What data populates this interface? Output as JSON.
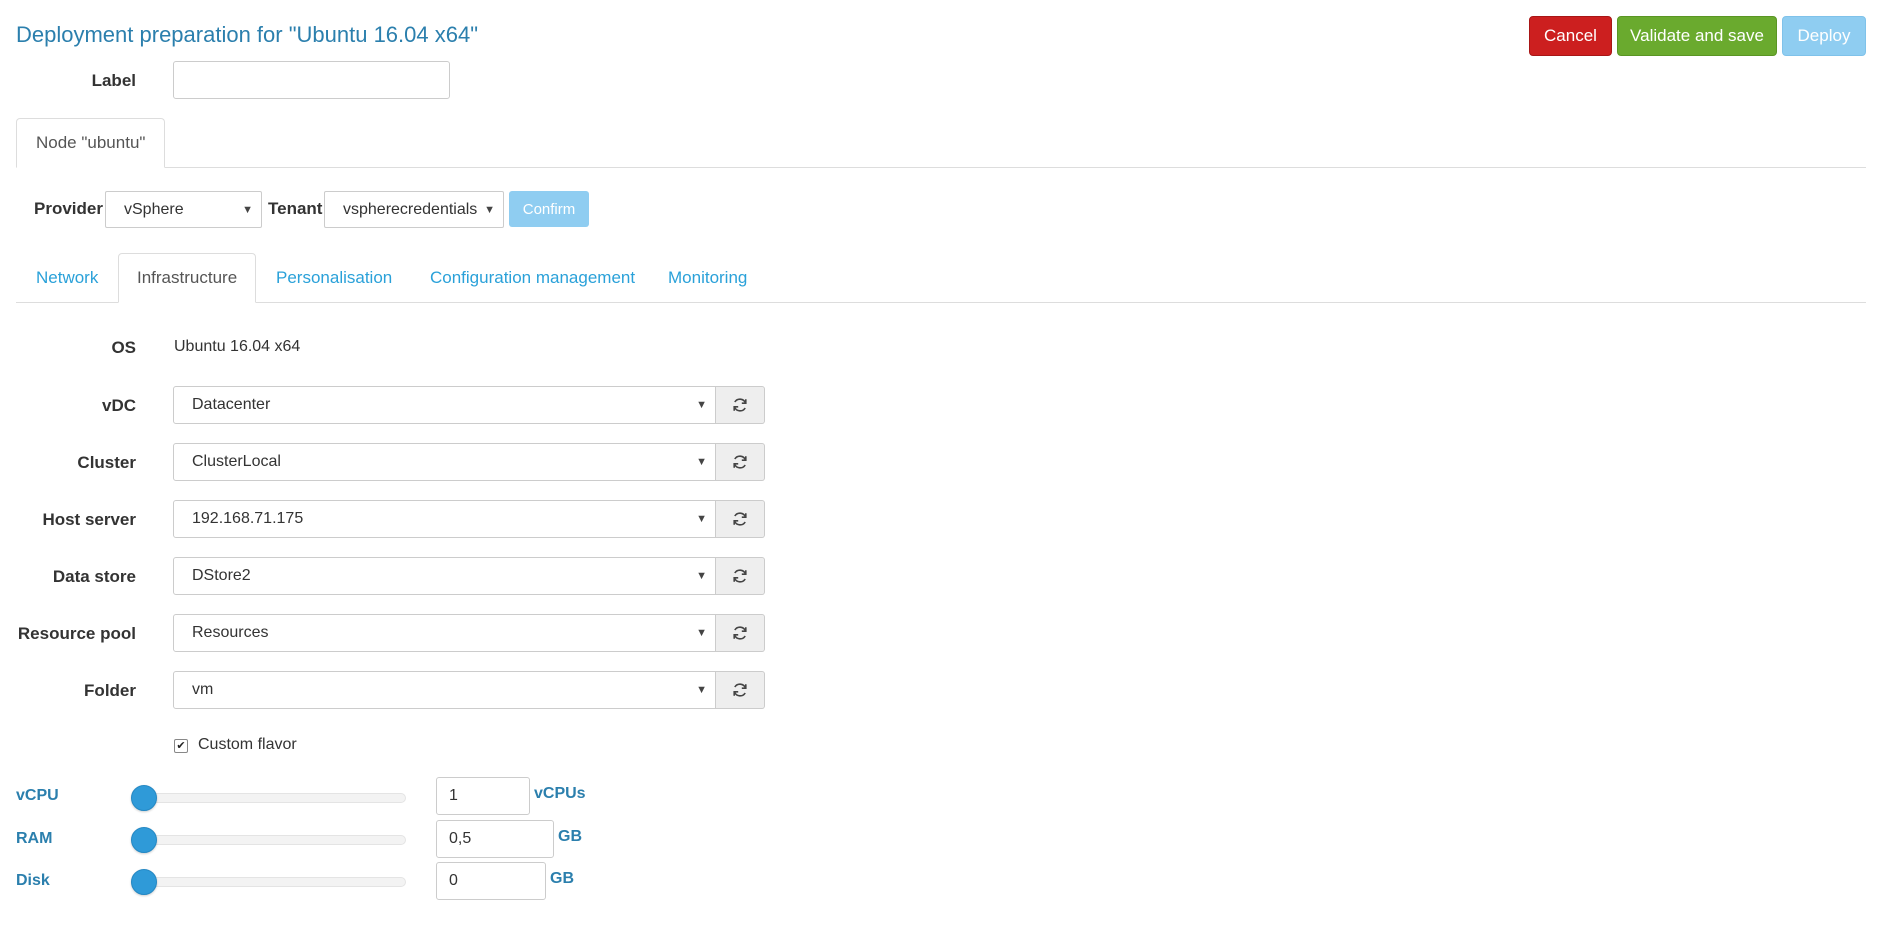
{
  "page": {
    "title": "Deployment preparation for \"Ubuntu 16.04 x64\""
  },
  "actions": {
    "cancel": "Cancel",
    "validate": "Validate and save",
    "deploy": "Deploy"
  },
  "label_field": {
    "label": "Label",
    "value": ""
  },
  "node_tab": {
    "label": "Node \"ubuntu\""
  },
  "provider": {
    "label": "Provider",
    "value": "vSphere",
    "tenant_label": "Tenant",
    "tenant_value": "vspherecredentials",
    "confirm": "Confirm"
  },
  "tabs": [
    {
      "label": "Network",
      "active": false
    },
    {
      "label": "Infrastructure",
      "active": true
    },
    {
      "label": "Personalisation",
      "active": false
    },
    {
      "label": "Configuration management",
      "active": false
    },
    {
      "label": "Monitoring",
      "active": false
    }
  ],
  "infrastructure": {
    "os": {
      "label": "OS",
      "value": "Ubuntu 16.04 x64"
    },
    "fields": [
      {
        "label": "vDC",
        "value": "Datacenter"
      },
      {
        "label": "Cluster",
        "value": "ClusterLocal"
      },
      {
        "label": "Host server",
        "value": "192.168.71.175"
      },
      {
        "label": "Data store",
        "value": "DStore2"
      },
      {
        "label": "Resource pool",
        "value": "Resources"
      },
      {
        "label": "Folder",
        "value": "vm"
      }
    ],
    "custom_flavor": {
      "label": "Custom flavor",
      "checked": true
    }
  },
  "sliders": {
    "vcpu": {
      "label": "vCPU",
      "value": "1",
      "unit": "vCPUs",
      "level": 0
    },
    "ram": {
      "label": "RAM",
      "value": "0,5",
      "unit": "GB",
      "level": 0
    },
    "disk": {
      "label": "Disk",
      "value": "0",
      "unit": "GB",
      "level": 0
    }
  },
  "icons": {
    "refresh": "refresh-icon",
    "caret": "caret-down-icon",
    "check": "checkmark-icon"
  },
  "colors": {
    "title": "#2b7fad",
    "cancel": "#cc1f1f",
    "validate": "#6aaa2e",
    "deploy": "#8fcdf1",
    "tab_link": "#2aa1d9",
    "slider": "#2f9ad8"
  }
}
